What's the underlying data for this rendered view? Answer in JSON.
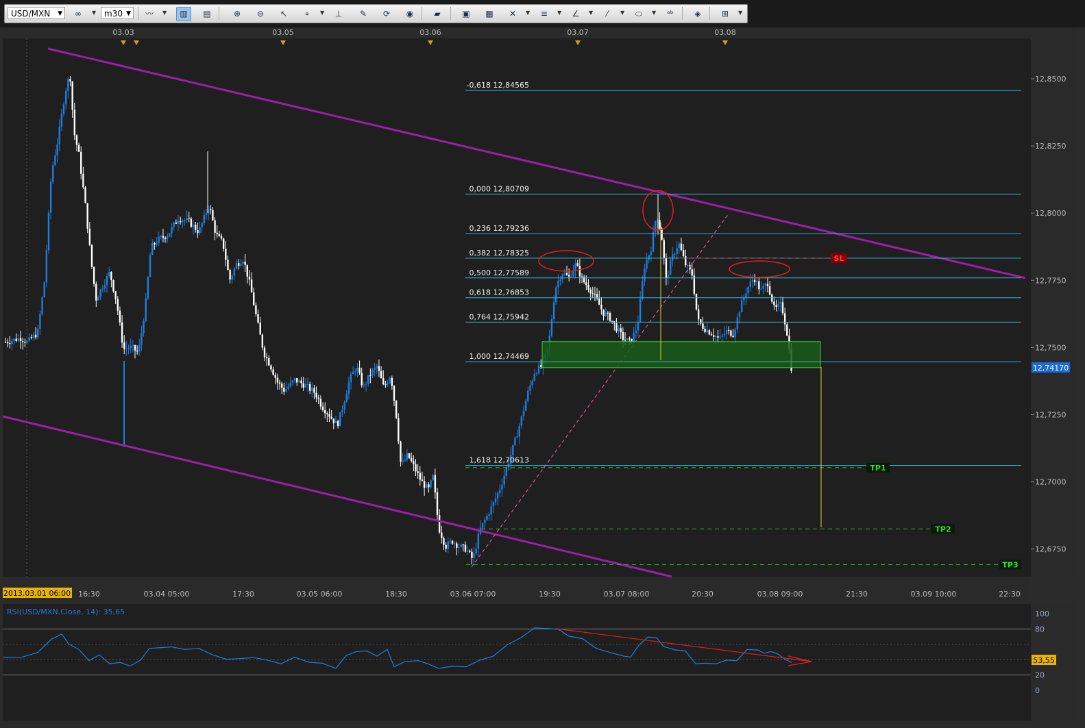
{
  "toolbar": {
    "symbol": "USD/MXN",
    "timeframe": "m30",
    "buttons": [
      "chart-type-icon",
      "candles-icon",
      "bar-icon",
      "zoom-in-icon",
      "zoom-out-icon",
      "cursor-icon",
      "crosshair-icon",
      "period-separator-icon",
      "edit-icon",
      "refresh-icon",
      "globe-icon",
      "ruler-icon",
      "image-icon",
      "template-icon",
      "tools-icon",
      "lines-icon",
      "fibonacci-icon",
      "trendline-icon",
      "ellipse-icon",
      "text-icon",
      "eraser-icon",
      "hierarchy-icon"
    ]
  },
  "chart": {
    "date_markers": [
      "03.03",
      "03.05",
      "03.06",
      "03.07",
      "03.08"
    ],
    "price_ticks": [
      "12,8500",
      "12,8250",
      "12,8000",
      "12,7750",
      "12,7500",
      "12,7250",
      "12,7000",
      "12,6750"
    ],
    "price_levels": [
      12.85,
      12.825,
      12.8,
      12.775,
      12.75,
      12.725,
      12.7,
      12.675
    ],
    "current_price": "12,74170",
    "current_price_value": 12.7417,
    "time_labels": [
      "2013.03.01 06:00",
      "16:30",
      "03.04 05:00",
      "17:30",
      "03.05 06:00",
      "18:30",
      "03.06 07:00",
      "19:30",
      "03.07 08:00",
      "20:30",
      "03.08 09:00",
      "21:30",
      "03.09 10:00",
      "22:30"
    ],
    "fib_levels": [
      {
        "label": "-0,618 12,84565",
        "price": 12.84565
      },
      {
        "label": "0,000 12,80709",
        "price": 12.80709
      },
      {
        "label": "0,236 12,79236",
        "price": 12.79236
      },
      {
        "label": "0,382 12,78325",
        "price": 12.78325
      },
      {
        "label": "0,500 12,77589",
        "price": 12.77589
      },
      {
        "label": "0,618 12,76853",
        "price": 12.76853
      },
      {
        "label": "0,764 12,75942",
        "price": 12.75942
      },
      {
        "label": "1,000 12,74469",
        "price": 12.74469
      },
      {
        "label": "1,618 12,70613",
        "price": 12.70613
      }
    ],
    "targets": [
      {
        "label": "SL",
        "price": 12.7832,
        "color": "#cc0000"
      },
      {
        "label": "TP1",
        "price": 12.7053,
        "color": "#00c800"
      },
      {
        "label": "TP2",
        "price": 12.6825,
        "color": "#00c800"
      },
      {
        "label": "TP3",
        "price": 12.6692,
        "color": "#00c800"
      }
    ],
    "zone": {
      "top": 12.7522,
      "bottom": 12.7425,
      "color": "#1a5c1a"
    },
    "colors": {
      "background": "#1f1f1f",
      "bull": "#1e7fe0",
      "bear": "#ffffff",
      "channel": "#9b1fa8",
      "fib": "#33b5d9"
    }
  },
  "rsi": {
    "label": "RSI(USD/MXN.Close, 14): 35,65",
    "value_badge": "53,55",
    "scale_ticks": [
      "100",
      "80",
      "20",
      "0"
    ],
    "scale_values": [
      100,
      80,
      20,
      0
    ]
  }
}
